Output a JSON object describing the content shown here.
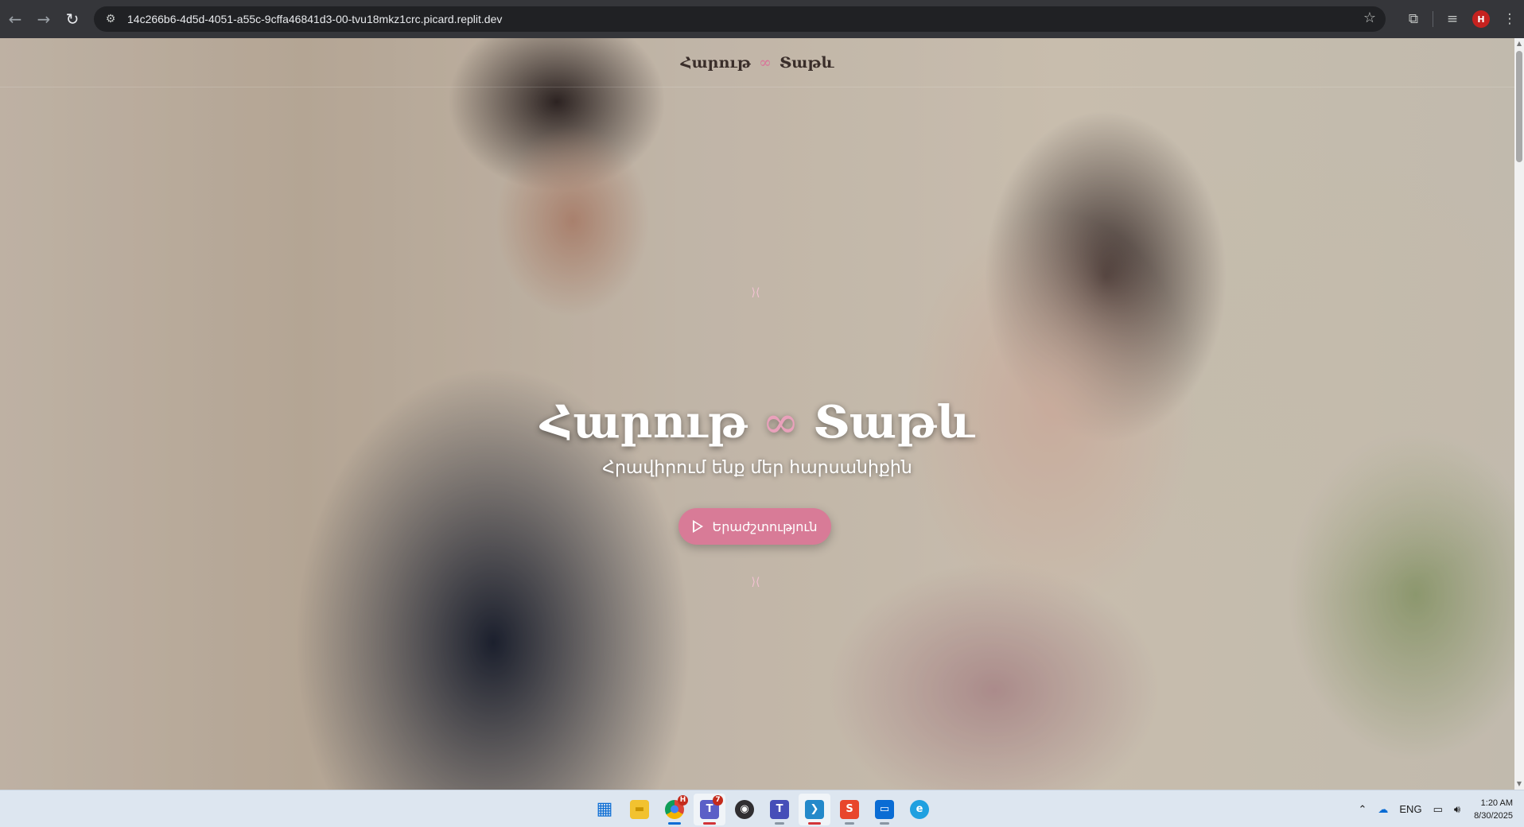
{
  "browser": {
    "url": "14c266b6-4d5d-4051-a55c-9cffa46841d3-00-tvu18mkz1crc.picard.replit.dev",
    "profile_initial": "H"
  },
  "site": {
    "brand_left": "Հարութ",
    "brand_symbol": "∞",
    "brand_right": "Տաթև",
    "ribbon": "⟩⟨",
    "hero_title_left": "Հարութ",
    "hero_title_symbol": "∞",
    "hero_title_right": "Տաթև",
    "hero_subtitle": "Հրավիրում ենք մեր հարսանիքին",
    "music_button": "Երաժշտություն",
    "accent_color": "#d87b97"
  },
  "taskbar": {
    "apps": [
      {
        "name": "start",
        "glyph": "▦"
      },
      {
        "name": "file-explorer",
        "glyph": "▬"
      },
      {
        "name": "chrome",
        "glyph": "●",
        "badge": "H"
      },
      {
        "name": "teams-classic",
        "glyph": "T",
        "badge": "7"
      },
      {
        "name": "obs",
        "glyph": "◉"
      },
      {
        "name": "teams",
        "glyph": "T"
      },
      {
        "name": "vscode",
        "glyph": "❯"
      },
      {
        "name": "sublime",
        "glyph": "S"
      },
      {
        "name": "remote-desktop",
        "glyph": "▭"
      },
      {
        "name": "edge",
        "glyph": "e"
      }
    ],
    "tray": {
      "language": "ENG",
      "time": "1:20 AM",
      "date": "8/30/2025"
    }
  }
}
